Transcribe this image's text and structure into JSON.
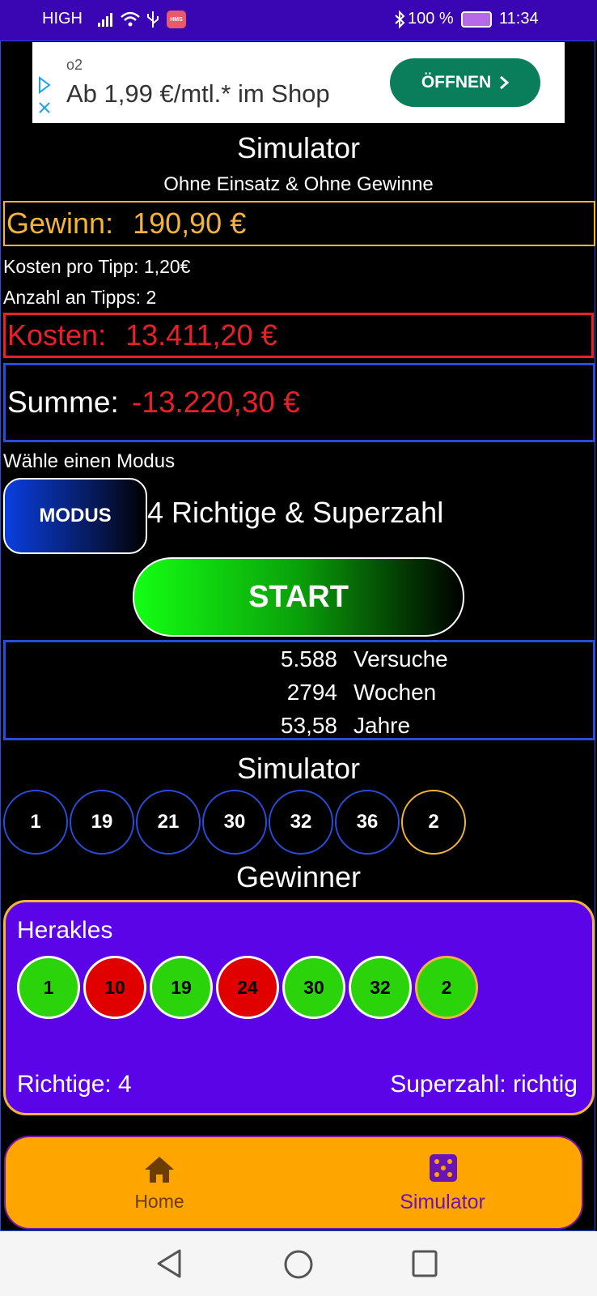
{
  "status_bar": {
    "carrier": "HIGH",
    "battery": "100 %",
    "time": "11:34",
    "hms_badge": "HMS"
  },
  "ad": {
    "brand": "o2",
    "text": "Ab 1,99 €/mtl.* im Shop",
    "button_label": "ÖFFNEN"
  },
  "header": {
    "title": "Simulator",
    "subtitle": "Ohne Einsatz & Ohne Gewinne"
  },
  "stats": {
    "gewinn_label": "Gewinn:",
    "gewinn_value": "190,90 €",
    "kosten_pro_tipp": "Kosten pro Tipp: 1,20€",
    "anzahl_tipps": "Anzahl an Tipps: 2",
    "kosten_label": "Kosten:",
    "kosten_value": "13.411,20 €",
    "summe_label": "Summe:",
    "summe_value": "-13.220,30 €"
  },
  "mode": {
    "prompt": "Wähle einen Modus",
    "button_label": "MODUS",
    "selected": "4 Richtige & Superzahl"
  },
  "start_button": "START",
  "counters": [
    {
      "value": "5.588",
      "unit": "Versuche"
    },
    {
      "value": "2794",
      "unit": "Wochen"
    },
    {
      "value": "53,58",
      "unit": "Jahre"
    }
  ],
  "simulator": {
    "title": "Simulator",
    "numbers": [
      "1",
      "19",
      "21",
      "30",
      "32",
      "36"
    ],
    "superzahl": "2"
  },
  "winner": {
    "title": "Gewinner",
    "name": "Herakles",
    "numbers": [
      "1",
      "10",
      "19",
      "24",
      "30",
      "32"
    ],
    "superzahl": "2",
    "richtige": "Richtige: 4",
    "superzahl_status": "Superzahl: richtig"
  },
  "colors": {
    "status_bar": "#3a06b3",
    "gewinn": "#f2b43a",
    "kosten": "#e8202a",
    "card": "#5b04e8",
    "nav": "#ffa500",
    "nav_active": "#6a14b8",
    "hit": "#2bd40a",
    "miss": "#e00000"
  },
  "bottom_nav": {
    "home_label": "Home",
    "simulator_label": "Simulator"
  }
}
